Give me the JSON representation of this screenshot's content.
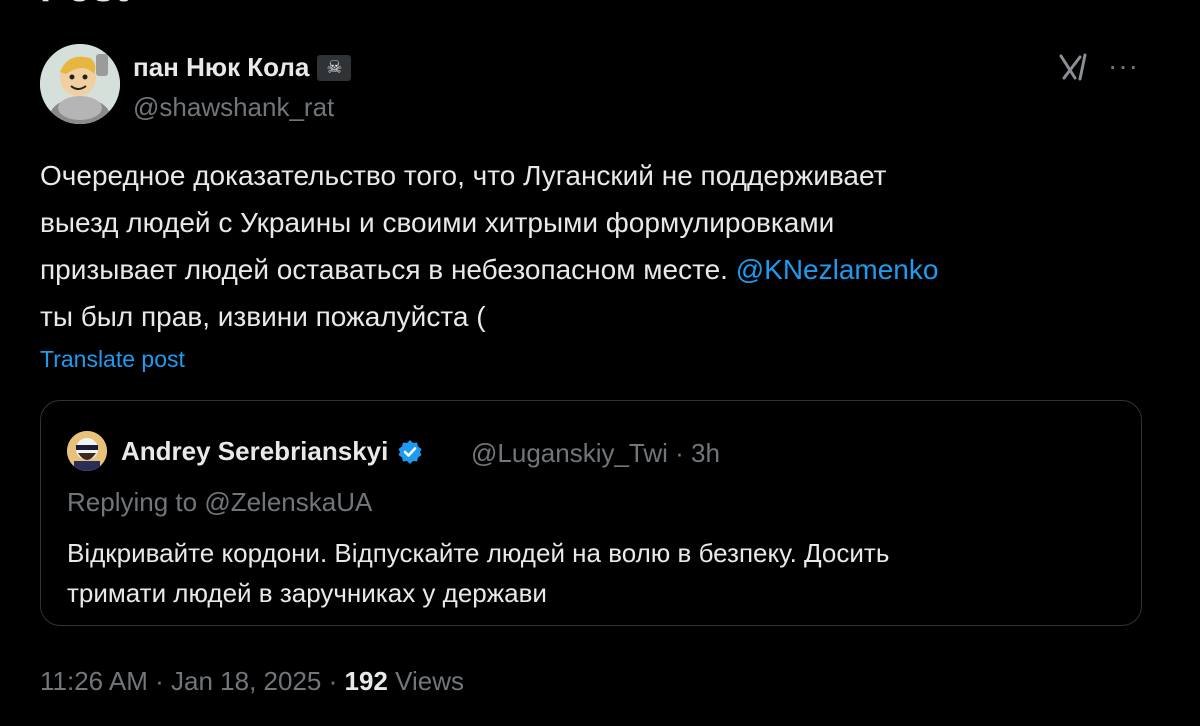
{
  "header": {
    "title": "Post"
  },
  "author": {
    "display_name": "пан Нюк Кола",
    "badge_emoji": "☠",
    "handle": "@shawshank_rat"
  },
  "actions": {
    "grok_icon": "grok-icon",
    "more_label": "···"
  },
  "post": {
    "lines": [
      "Очередное доказательство того, что Луганский не поддерживает",
      "выезд людей с Украины и своими хитрыми формулировками",
      "призывает людей оставаться в небезопасном месте. ",
      "ты был прав, извини пожалуйста ("
    ],
    "mention": "@KNezlamenko",
    "translate_label": "Translate post"
  },
  "quote": {
    "display_name": "Andrey Serebrianskyi",
    "handle": "@Luganskiy_Twi",
    "time": "· 3h",
    "replying_prefix": "Replying to ",
    "replying_to": "@ZelenskaUA",
    "lines": [
      "Відкривайте кордони. Відпускайте людей на волю в безпеку. Досить",
      "тримати людей в заручниках у держави"
    ]
  },
  "footer": {
    "timestamp": "11:26 AM · Jan 18, 2025 · ",
    "views_count": "192",
    "views_label": " Views"
  },
  "colors": {
    "background": "#000000",
    "text": "#e7e9ea",
    "muted": "#71767b",
    "link": "#1d9bf0",
    "border": "#2f3336"
  }
}
